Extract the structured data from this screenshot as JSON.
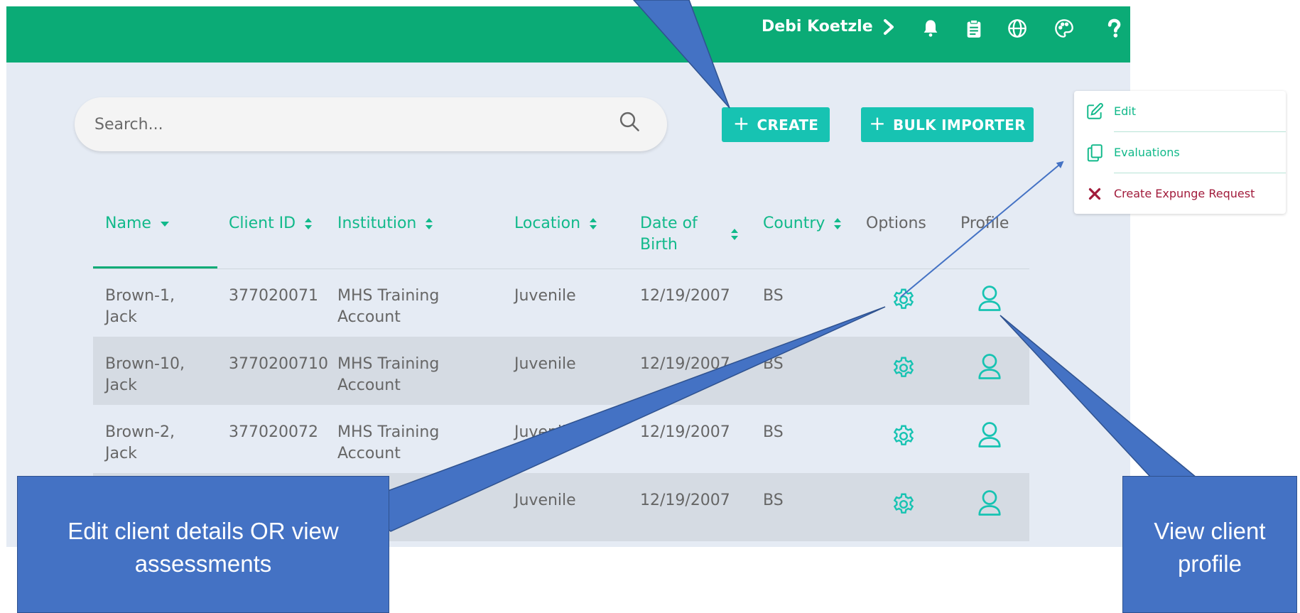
{
  "header": {
    "user_name": "Debi Koetzle",
    "icons": [
      "bell-icon",
      "clipboard-icon",
      "globe-icon",
      "palette-icon",
      "help-icon"
    ]
  },
  "search": {
    "placeholder": "Search..."
  },
  "toolbar": {
    "create_label": "CREATE",
    "bulk_label": "BULK IMPORTER"
  },
  "table": {
    "headers": {
      "name": "Name",
      "client_id": "Client ID",
      "institution": "Institution",
      "location": "Location",
      "dob_line1": "Date of",
      "dob_line2": "Birth",
      "country": "Country",
      "options": "Options",
      "profile": "Profile"
    },
    "rows": [
      {
        "name_line1": "Brown-1,",
        "name_line2": "Jack",
        "client_id": "377020071",
        "institution_line1": "MHS Training",
        "institution_line2": "Account",
        "location": "Juvenile",
        "dob": "12/19/2007",
        "country": "BS"
      },
      {
        "name_line1": "Brown-10,",
        "name_line2": "Jack",
        "client_id": "3770200710",
        "institution_line1": "MHS Training",
        "institution_line2": "Account",
        "location": "Juvenile",
        "dob": "12/19/2007",
        "country": "BS"
      },
      {
        "name_line1": "Brown-2,",
        "name_line2": "Jack",
        "client_id": "377020072",
        "institution_line1": "MHS Training",
        "institution_line2": "Account",
        "location": "Juvenile",
        "dob": "12/19/2007",
        "country": "BS"
      },
      {
        "name_line1": "",
        "name_line2": "",
        "client_id": "",
        "institution_line1": "",
        "institution_line2": "",
        "location": "Juvenile",
        "dob": "12/19/2007",
        "country": "BS"
      }
    ]
  },
  "options_menu": {
    "items": [
      {
        "label": "Edit",
        "icon": "edit-icon"
      },
      {
        "label": "Evaluations",
        "icon": "copy-icon"
      },
      {
        "label": "Create Expunge Request",
        "icon": "close-icon"
      }
    ]
  },
  "callouts": {
    "left_line1": "Edit client details OR view",
    "left_line2": "assessments",
    "right_line1": "View client",
    "right_line2": "profile"
  },
  "colors": {
    "header_green": "#0bab76",
    "accent_teal": "#17c3b2",
    "callout_blue": "#4472c4",
    "danger": "#a11b3b"
  }
}
